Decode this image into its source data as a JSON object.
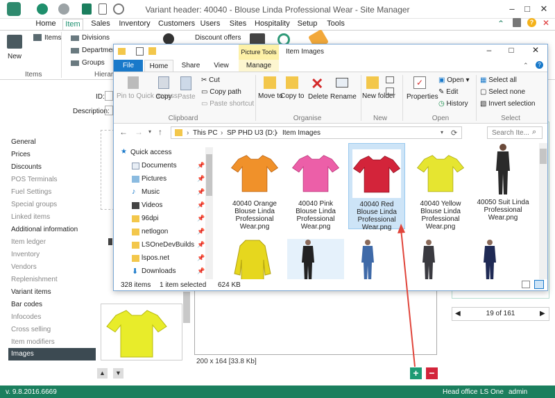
{
  "app": {
    "title": "Variant header: 40040 - Blouse Linda Professional Wear - Site Manager"
  },
  "menu": {
    "tabs": [
      "Home",
      "Item",
      "Sales",
      "Inventory",
      "Customers",
      "Users",
      "Sites",
      "Hospitality",
      "Setup",
      "Tools"
    ],
    "active": "Item"
  },
  "ribbon": {
    "new_label": "New",
    "items_label": "Items",
    "items_group": "Items",
    "divisions": "Divisions",
    "departments": "Department",
    "groups": "Groups",
    "hierarchy": "Hierar",
    "discount_offers": "Discount offers"
  },
  "form": {
    "id_label": "ID:",
    "description_label": "Description:"
  },
  "nav": {
    "items": [
      {
        "label": "General",
        "state": "normal"
      },
      {
        "label": "Prices",
        "state": "normal"
      },
      {
        "label": "Discounts",
        "state": "normal"
      },
      {
        "label": "POS Terminals",
        "state": "dim"
      },
      {
        "label": "Fuel Settings",
        "state": "dim"
      },
      {
        "label": "Special groups",
        "state": "dim"
      },
      {
        "label": "Linked items",
        "state": "dim"
      },
      {
        "label": "Additional information",
        "state": "normal"
      },
      {
        "label": "Item ledger",
        "state": "dim"
      },
      {
        "label": "Inventory",
        "state": "dim"
      },
      {
        "label": "Vendors",
        "state": "dim"
      },
      {
        "label": "Replenishment",
        "state": "dim"
      },
      {
        "label": "Variant items",
        "state": "normal"
      },
      {
        "label": "Bar codes",
        "state": "normal"
      },
      {
        "label": "Infocodes",
        "state": "dim"
      },
      {
        "label": "Cross selling",
        "state": "dim"
      },
      {
        "label": "Item modifiers",
        "state": "dim"
      },
      {
        "label": "Images",
        "state": "selected"
      }
    ]
  },
  "image_panel": {
    "size_text": "200 x 164 [33.8 Kb]"
  },
  "pager": {
    "text": "19 of 161"
  },
  "status": {
    "version": "v. 9.8.2016.6669",
    "site": "Head office",
    "product": "LS One",
    "user": "admin"
  },
  "explorer": {
    "picture_tools": "Picture Tools",
    "title": "Item Images",
    "tabs": {
      "file": "File",
      "home": "Home",
      "share": "Share",
      "view": "View",
      "manage": "Manage"
    },
    "clipboard": {
      "pin": "Pin to Quick access",
      "copy": "Copy",
      "paste": "Paste",
      "cut": "Cut",
      "copy_path": "Copy path",
      "paste_shortcut": "Paste shortcut",
      "group": "Clipboard"
    },
    "organise": {
      "move_to": "Move to",
      "copy_to": "Copy to",
      "delete": "Delete",
      "rename": "Rename",
      "group": "Organise"
    },
    "new": {
      "new_folder": "New folder",
      "group": "New"
    },
    "open": {
      "properties": "Properties",
      "open": "Open",
      "edit": "Edit",
      "history": "History",
      "group": "Open"
    },
    "select": {
      "select_all": "Select all",
      "select_none": "Select none",
      "invert": "Invert selection",
      "group": "Select"
    },
    "breadcrumb": [
      "This PC",
      "SP PHD U3 (D:)",
      "Item Images"
    ],
    "search_placeholder": "Search Ite...",
    "sidebar": [
      "Quick access",
      "Documents",
      "Pictures",
      "Music",
      "Videos",
      "96dpi",
      "netlogon",
      "LSOneDevBuilds",
      "lspos.net",
      "Downloads"
    ],
    "files": [
      {
        "name": "40040 Orange Blouse Linda Professional Wear.png",
        "color": "#f0912a"
      },
      {
        "name": "40040 Pink Blouse Linda Professional Wear.png",
        "color": "#ec5fa8"
      },
      {
        "name": "40040 Red Blouse Linda Professional Wear.png",
        "color": "#d3243a"
      },
      {
        "name": "40040 Yellow Blouse Linda Professional Wear.png",
        "color": "#e6e530"
      },
      {
        "name": "40050 Suit Linda Professional Wear.png",
        "color": "#2a2a2a"
      }
    ],
    "status_count": "328 items",
    "status_selected": "1 item selected",
    "status_size": "624 KB"
  }
}
